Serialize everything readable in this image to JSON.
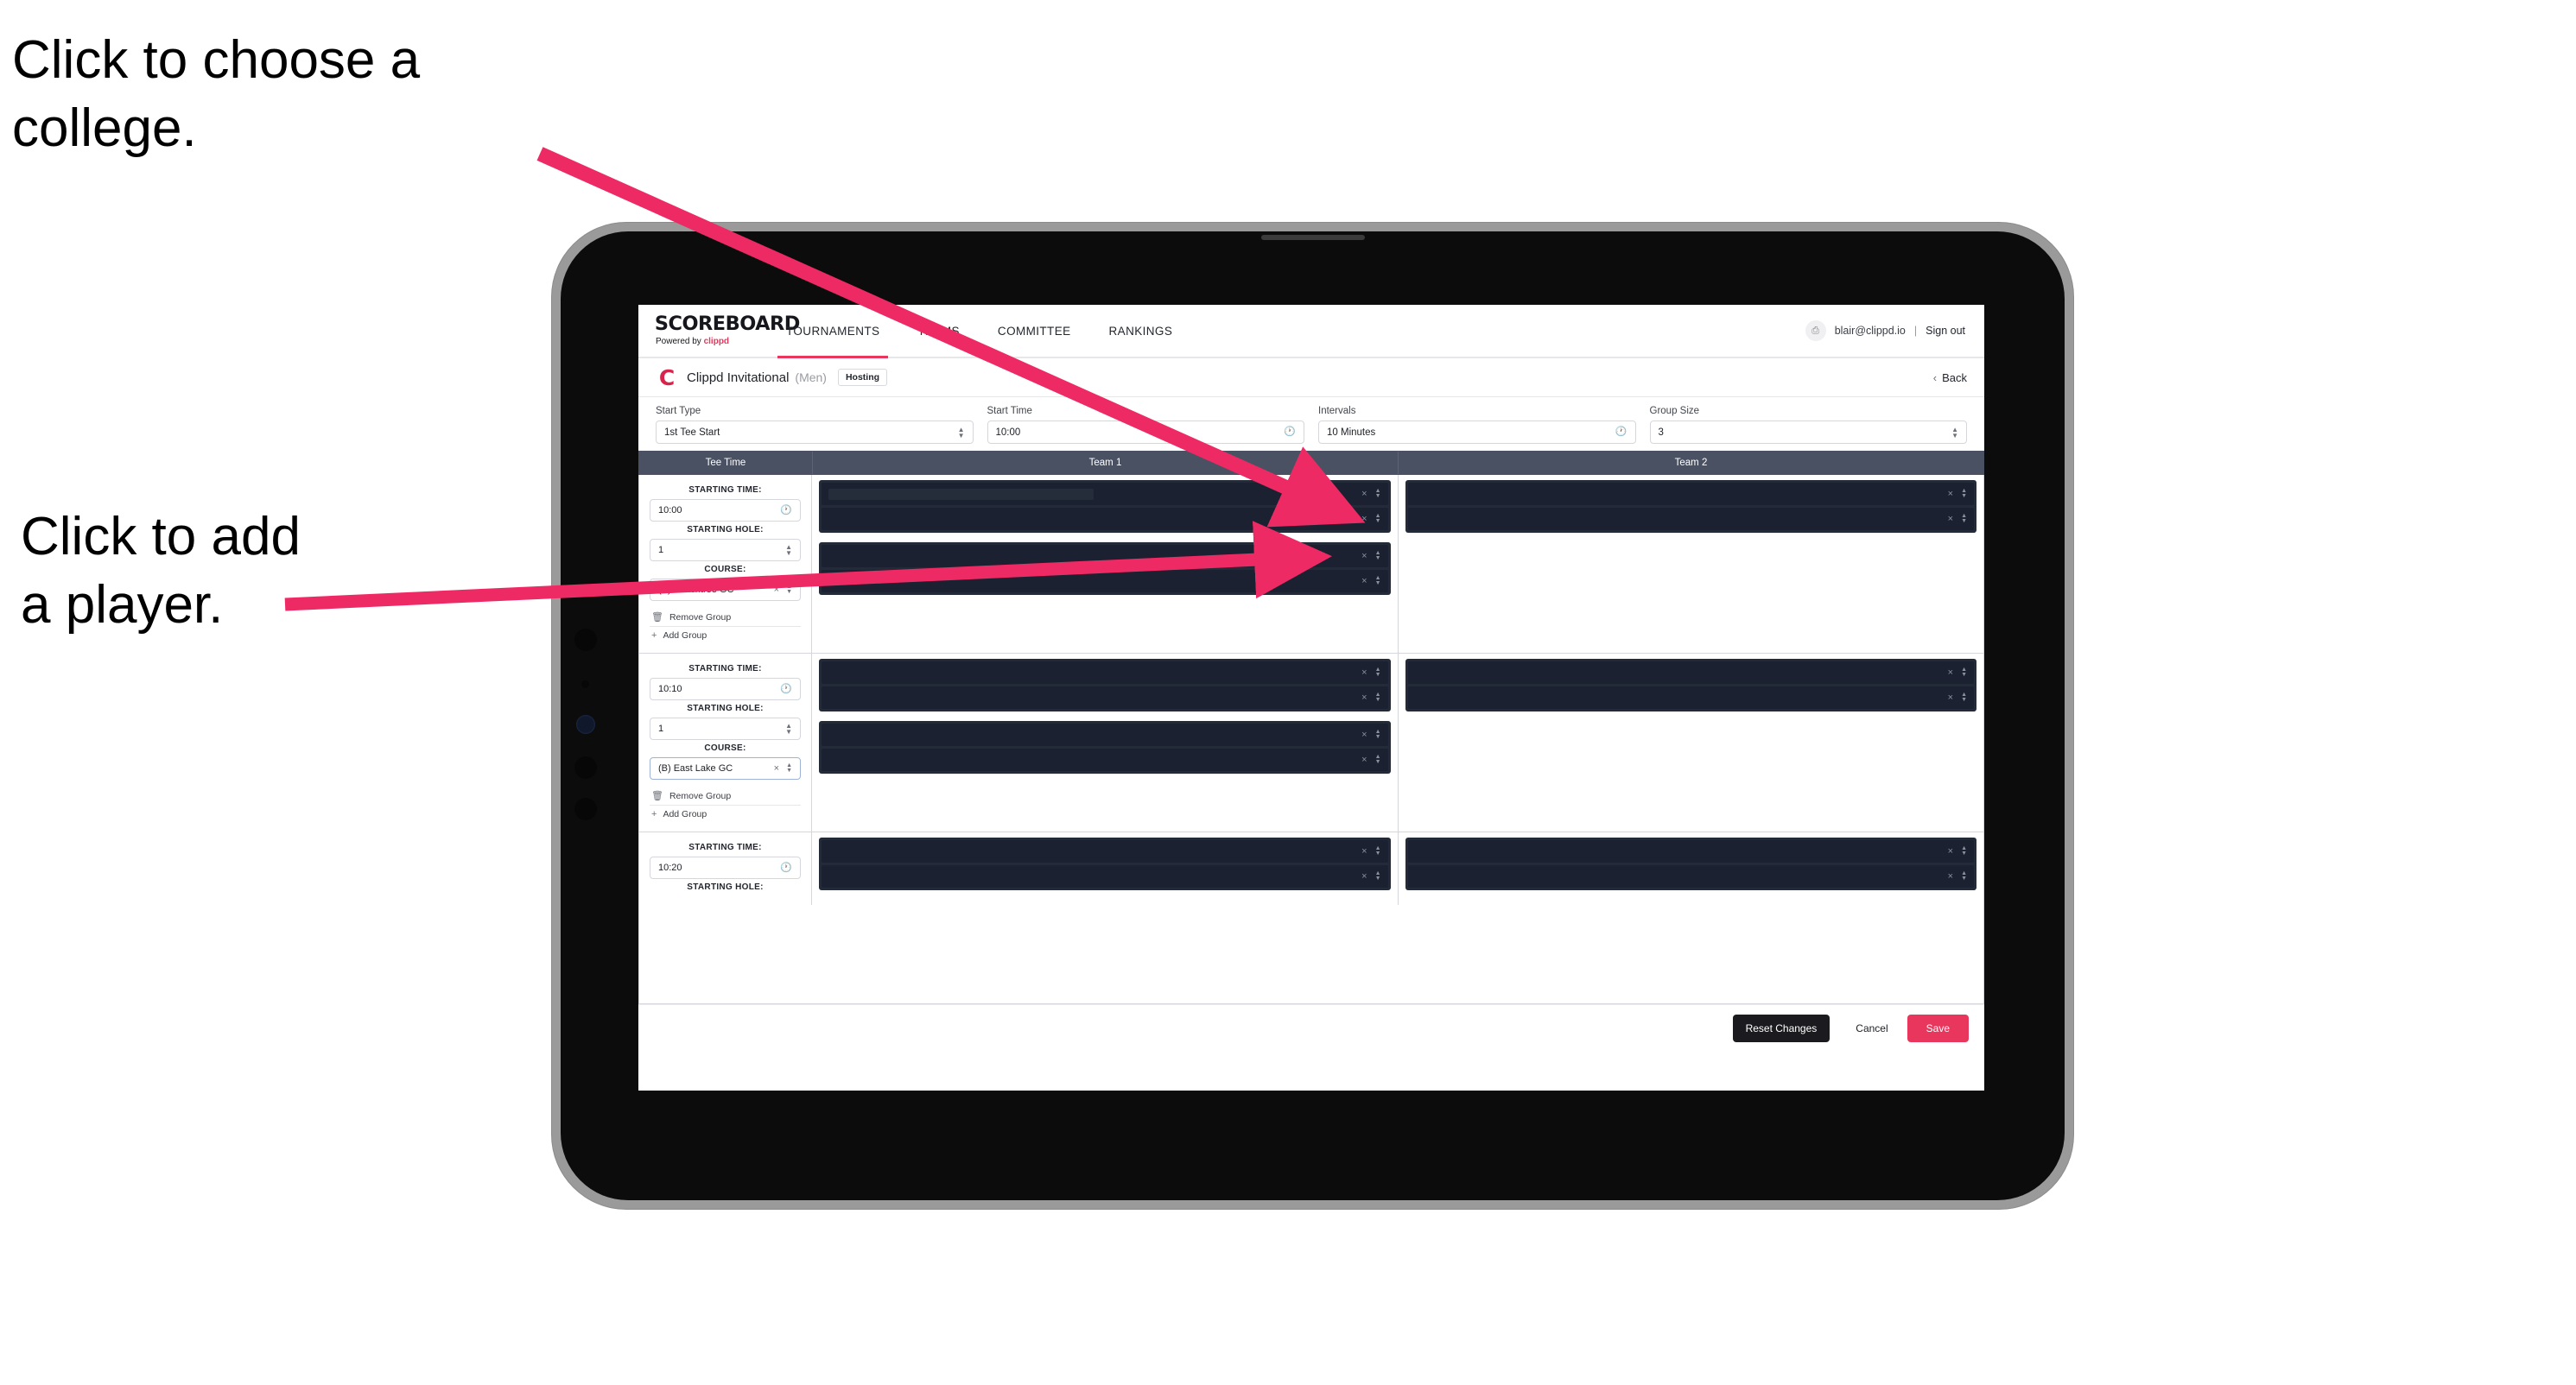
{
  "annotations": [
    {
      "id": "college",
      "text": "Click to choose a\ncollege."
    },
    {
      "id": "player",
      "text": "Click to add\na player."
    }
  ],
  "colors": {
    "accent": "#e8365d",
    "header_bar": "#4a5162",
    "dark_slot": "#232a38",
    "reset_btn": "#1b1b1f"
  },
  "header": {
    "logo_main": "SCOREBOARD",
    "logo_sub_prefix": "Powered by ",
    "logo_sub_brand": "clippd",
    "nav": [
      {
        "label": "TOURNAMENTS",
        "active": true
      },
      {
        "label": "TEAMS",
        "active": false
      },
      {
        "label": "COMMITTEE",
        "active": false
      },
      {
        "label": "RANKINGS",
        "active": false
      }
    ],
    "avatar_glyph": "⎙",
    "email": "blair@clippd.io",
    "separator": "|",
    "sign_out": "Sign out"
  },
  "breadcrumb": {
    "logo_letter": "C",
    "title": "Clippd Invitational",
    "gender": "(Men)",
    "badge": "Hosting",
    "back_label": "Back",
    "back_chevron": "‹"
  },
  "settings": [
    {
      "label": "Start Type",
      "value": "1st Tee Start",
      "adorn": "stepper"
    },
    {
      "label": "Start Time",
      "value": "10:00",
      "adorn": "clock"
    },
    {
      "label": "Intervals",
      "value": "10 Minutes",
      "adorn": "clock"
    },
    {
      "label": "Group Size",
      "value": "3",
      "adorn": "stepper"
    }
  ],
  "table": {
    "columns": [
      "Tee Time",
      "Team 1",
      "Team 2"
    ],
    "captions": {
      "time": "STARTING TIME:",
      "hole": "STARTING HOLE:",
      "course": "COURSE:"
    },
    "group_actions": {
      "remove": "Remove Group",
      "add": "Add Group",
      "remove_icon": "☐",
      "add_icon": "+"
    },
    "slot_icons": {
      "clear": "×",
      "reorder": "⇅"
    },
    "rows": [
      {
        "starting_time": "10:00",
        "starting_hole": "1",
        "course": "(A) Peachtree GC",
        "course_focused": false,
        "team1_groups": [
          {
            "slots": [
              {
                "redact_width": "48%"
              },
              {
                "redact_width": "0%"
              }
            ]
          },
          {
            "slots": [
              {
                "redact_width": "0%"
              },
              {
                "redact_width": "0%"
              }
            ]
          }
        ],
        "team2_groups": [
          {
            "slots": [
              {
                "redact_width": "0%"
              },
              {
                "redact_width": "0%"
              }
            ]
          }
        ]
      },
      {
        "starting_time": "10:10",
        "starting_hole": "1",
        "course": "(B) East Lake GC",
        "course_focused": true,
        "team1_groups": [
          {
            "slots": [
              {
                "redact_width": "0%"
              },
              {
                "redact_width": "0%"
              }
            ]
          },
          {
            "slots": [
              {
                "redact_width": "0%"
              },
              {
                "redact_width": "0%"
              }
            ]
          }
        ],
        "team2_groups": [
          {
            "slots": [
              {
                "redact_width": "0%"
              },
              {
                "redact_width": "0%"
              }
            ]
          }
        ]
      },
      {
        "starting_time": "10:20",
        "starting_hole": "",
        "course": "",
        "course_focused": false,
        "partial": true,
        "team1_groups": [
          {
            "slots": [
              {
                "redact_width": "0%"
              },
              {
                "redact_width": "0%"
              }
            ]
          }
        ],
        "team2_groups": [
          {
            "slots": [
              {
                "redact_width": "0%"
              },
              {
                "redact_width": "0%"
              }
            ]
          }
        ]
      }
    ]
  },
  "footer": {
    "reset_label": "Reset Changes",
    "cancel_label": "Cancel",
    "save_label": "Save"
  }
}
